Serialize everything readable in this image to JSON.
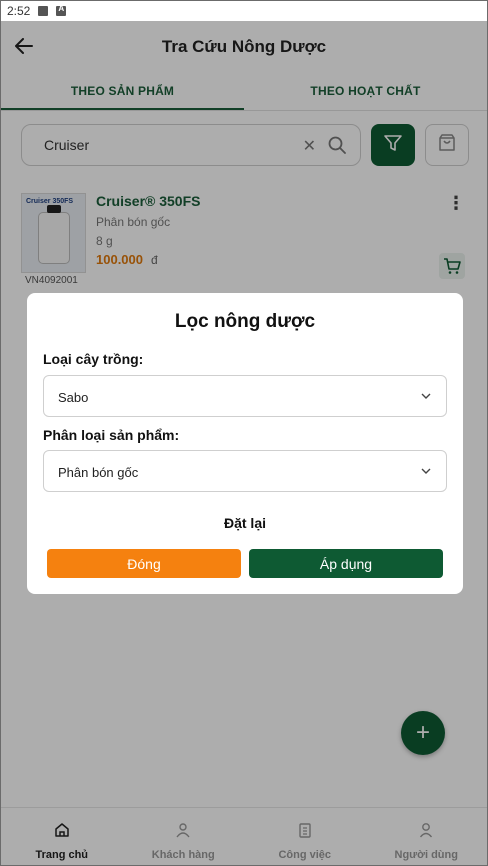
{
  "status_bar": {
    "time": "2:52"
  },
  "header": {
    "title": "Tra Cứu Nông Dược"
  },
  "tabs": [
    {
      "label": "THEO SẢN PHẨM",
      "active": true
    },
    {
      "label": "THEO HOẠT CHẤT",
      "active": false
    }
  ],
  "search": {
    "value": "Cruiser"
  },
  "product": {
    "name": "Cruiser® 350FS",
    "type": "Phân bón gốc",
    "weight": "8 g",
    "price": "100.000",
    "currency": "đ",
    "code": "VN4092001",
    "image_brand": "Cruiser 350FS"
  },
  "dialog": {
    "title": "Lọc nông dược",
    "crop_label": "Loại cây trồng:",
    "crop_value": "Sabo",
    "category_label": "Phân loại sản phẩm:",
    "category_value": "Phân bón gốc",
    "reset_label": "Đặt lại",
    "close_label": "Đóng",
    "apply_label": "Áp dụng"
  },
  "bottom_nav": [
    {
      "label": "Trang chủ",
      "icon": "home-icon",
      "active": true
    },
    {
      "label": "Khách hàng",
      "icon": "user-icon",
      "active": false
    },
    {
      "label": "Công việc",
      "icon": "clipboard-icon",
      "active": false
    },
    {
      "label": "Người dùng",
      "icon": "person-icon",
      "active": false
    }
  ],
  "colors": {
    "primary_green": "#0e5a33",
    "accent_orange": "#f5810f",
    "price_orange": "#e07a0d"
  }
}
